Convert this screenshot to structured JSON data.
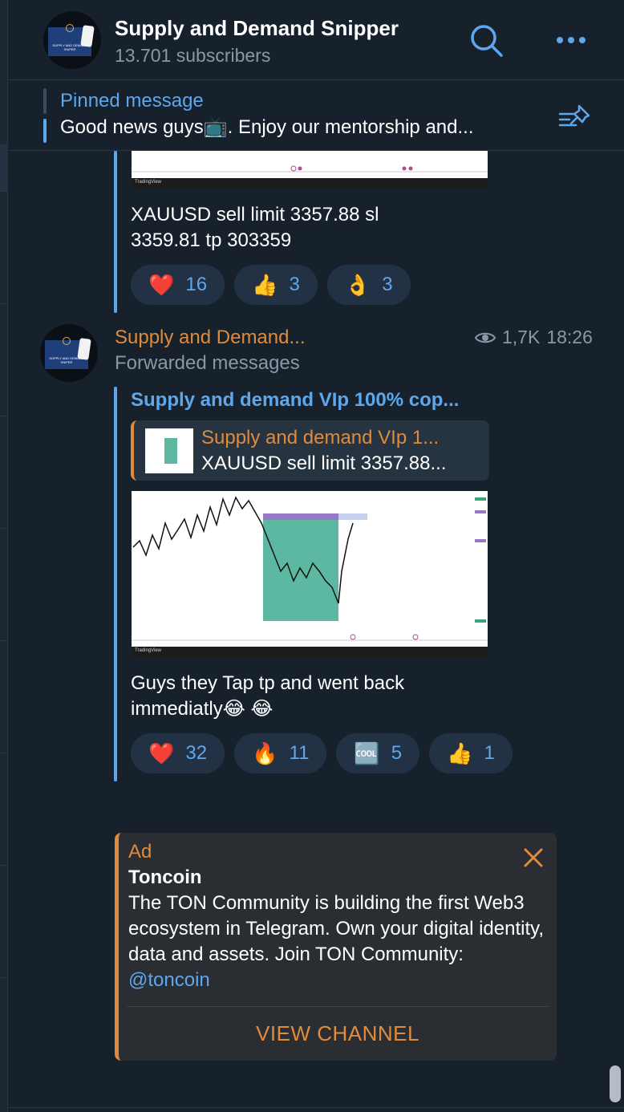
{
  "header": {
    "title": "Supply and Demand Snipper",
    "subscribers": "13.701 subscribers",
    "avatar_text": "SUPPLY AND DEMAND SNIPER"
  },
  "pinned": {
    "title": "Pinned message",
    "text": "Good news guys📺.  Enjoy our mentorship and..."
  },
  "message1": {
    "chart_brand": "TradingView",
    "text_line1": "XAUUSD sell limit 3357.88 sl",
    "text_line2": "3359.81 tp 303359",
    "reactions": [
      {
        "emoji": "❤️",
        "count": "16"
      },
      {
        "emoji": "👍",
        "count": "3"
      },
      {
        "emoji": "👌",
        "count": "3"
      }
    ]
  },
  "message2": {
    "sender": "Supply and Demand...",
    "forwarded": "Forwarded messages",
    "views": "1,7K",
    "time": "18:26",
    "fwd_title": "Supply and demand VIp 100% cop...",
    "reply": {
      "title": "Supply and demand VIp 1...",
      "text": "XAUUSD sell limit 3357.88..."
    },
    "chart_brand": "TradingView",
    "text_line1": "Guys they Tap tp and went back",
    "text_line2": "immediatly😂 😂",
    "reactions": [
      {
        "emoji": "❤️",
        "count": "32"
      },
      {
        "emoji": "🔥",
        "count": "11"
      },
      {
        "emoji": "🆒",
        "count": "5"
      },
      {
        "emoji": "👍",
        "count": "1"
      }
    ]
  },
  "ad": {
    "label": "Ad",
    "title": "Toncoin",
    "body": "The TON Community is building the first Web3 ecosystem in Telegram. Own your digital identity, data and assets. Join TON Community: ",
    "link": "@toncoin",
    "cta": "VIEW CHANNEL"
  },
  "colors": {
    "background": "#17212b",
    "accent_blue": "#5ea7ec",
    "accent_orange": "#e08a3c",
    "reaction_bg": "#223244",
    "ad_bg": "#2a2e33",
    "chart_zone": "#5cb8a0"
  }
}
